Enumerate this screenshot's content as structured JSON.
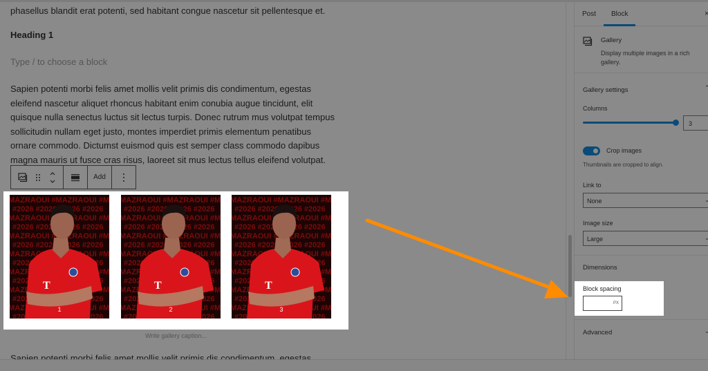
{
  "editor": {
    "paragraph_top": "phasellus blandit erat potenti, sed habitant congue nascetur sit pellentesque et.",
    "heading": "Heading 1",
    "placeholder": "Type / to choose a block",
    "paragraph_main": "Sapien potenti morbi felis amet mollis velit primis dis condimentum, egestas eleifend nascetur aliquet rhoncus habitant enim conubia augue tincidunt, elit quisque nulla senectus luctus sit lectus turpis. Donec rutrum mus volutpat tempus sollicitudin nullam eget justo, montes imperdiet primis elementum penatibus ornare commodo. Dictumst euismod quis est semper class commodo dapibus magna mauris ut fusce cras risus, laoreet sit mus lectus tellus eleifend volutpat.",
    "paragraph_bottom": "Sapien potenti morbi felis amet mollis velit primis dis condimentum, egestas",
    "toolbar": {
      "block_type_icon": "gallery-icon",
      "drag_icon": "drag-handle-icon",
      "move_icon": "move-up-down-icon",
      "align_icon": "align-icon",
      "add_label": "Add",
      "options_icon": "more-vertical-icon"
    },
    "gallery": {
      "images": [
        {
          "number": "1",
          "text_pattern": [
            "#MAZRAOUI",
            "#2026"
          ]
        },
        {
          "number": "2",
          "text_pattern": [
            "#MAZRAOUI",
            "#2026"
          ]
        },
        {
          "number": "3",
          "text_pattern": [
            "#MAZRAOUI",
            "#2026"
          ]
        }
      ],
      "caption_placeholder": "Write gallery caption..."
    }
  },
  "sidebar": {
    "tabs": [
      {
        "label": "Post",
        "active": false
      },
      {
        "label": "Block",
        "active": true
      }
    ],
    "close_icon": "close-icon",
    "block_card": {
      "title": "Gallery",
      "description": "Display multiple images in a rich gallery."
    },
    "gallery_settings": {
      "title": "Gallery settings",
      "columns_label": "Columns",
      "columns_value": "3",
      "columns_slider_fraction": 1.0,
      "crop_label": "Crop images",
      "crop_enabled": true,
      "crop_help": "Thumbnails are cropped to align.",
      "link_to_label": "Link to",
      "link_to_value": "None",
      "image_size_label": "Image size",
      "image_size_value": "Large"
    },
    "dimensions": {
      "title": "Dimensions",
      "block_spacing_label": "Block spacing",
      "block_spacing_value": "",
      "block_spacing_unit": "PX"
    },
    "advanced": {
      "title": "Advanced"
    }
  },
  "colors": {
    "accent": "#0a4b78",
    "annotation_arrow": "#ff8c00",
    "overlay": "#8a8a8a"
  }
}
